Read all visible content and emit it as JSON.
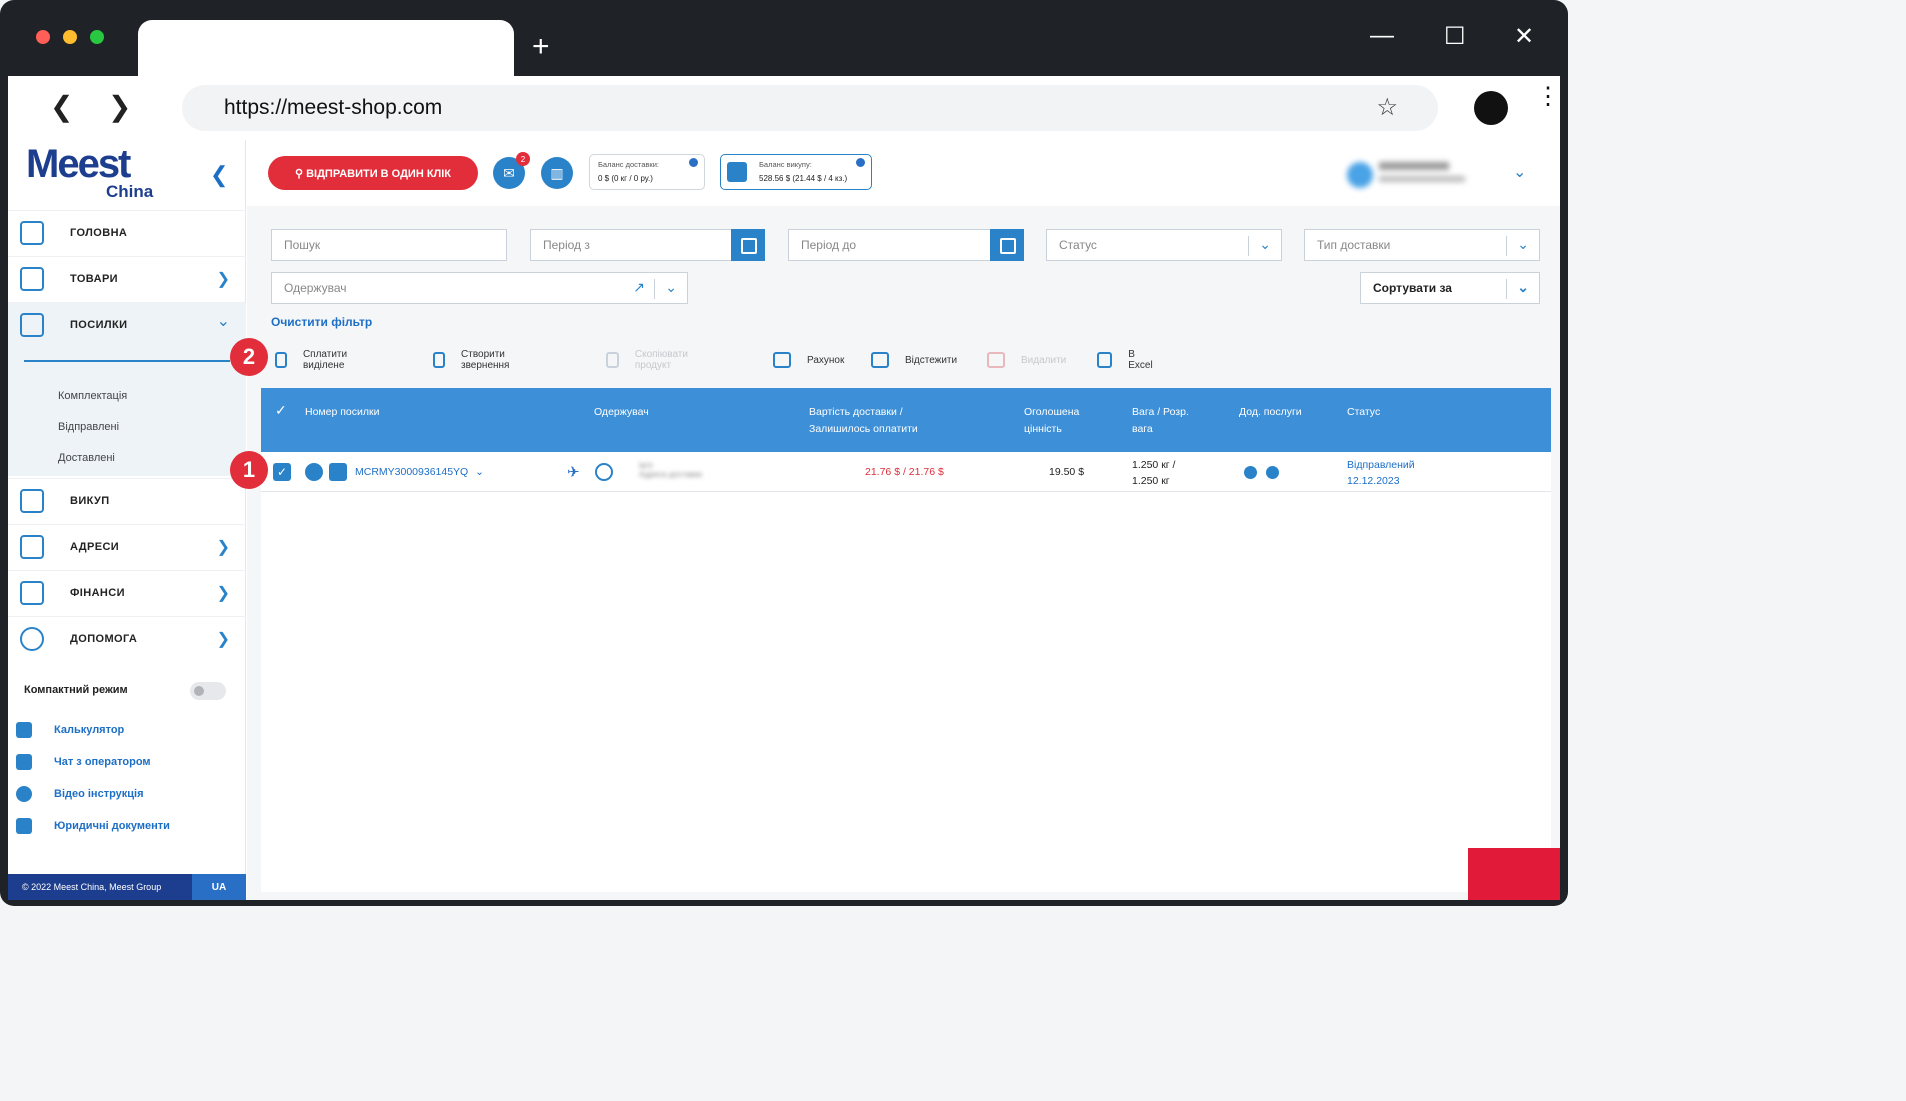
{
  "browser": {
    "url": "https://meest-shop.com",
    "new_tab": "+",
    "back": "❮",
    "forward": "❯",
    "minimize": "—",
    "maximize": "☐",
    "close": "✕",
    "star": "☆",
    "menu": "⋮",
    "traffic_lights": {
      "red": "#ff5f57",
      "yellow": "#febc2e",
      "green": "#28c840"
    }
  },
  "logo": {
    "main": "Meest",
    "sub": "China"
  },
  "sidebar": {
    "collapse": "❮",
    "items": [
      {
        "label": "Головна",
        "chevron": ""
      },
      {
        "label": "Товари",
        "chevron": "❯"
      },
      {
        "label": "Посилки",
        "chevron": "⌄"
      },
      {
        "label": "Викуп",
        "chevron": ""
      },
      {
        "label": "Адреси",
        "chevron": "❯"
      },
      {
        "label": "Фінанси",
        "chevron": "❯"
      },
      {
        "label": "Допомога",
        "chevron": "❯"
      }
    ],
    "submenu": [
      "Комплектація",
      "Відправлені",
      "Доставлені"
    ],
    "compact_label": "Компактний режим",
    "links": [
      "Калькулятор",
      "Чат з оператором",
      "Відео інструкція",
      "Юридичні документи"
    ],
    "footer_copy": "© 2022 Meest China, Meest Group",
    "footer_lang": "UA"
  },
  "header": {
    "send_button": "⚲ ВІДПРАВИТИ В ОДИН КЛІК",
    "mail_badge": "2",
    "delivery_balance_title": "Баланс доставки:",
    "delivery_balance_value": "0 $ (0 кг / 0 ру.)",
    "purchase_balance_title": "Баланс викупу:",
    "purchase_balance_value": "528.56 $ (21.44 $ / 4 кз.)",
    "user_chevron": "⌄"
  },
  "filters": {
    "search_placeholder": "Пошук",
    "period_from": "Період з",
    "period_to": "Період до",
    "status": "Статус",
    "delivery_type": "Тип доставки",
    "recipient": "Одержувач",
    "sort_by": "Сортувати за",
    "clear": "Очистити фільтр",
    "chevron": "⌄"
  },
  "actions": [
    {
      "label": "Сплатити виділене",
      "enabled": true
    },
    {
      "label": "Створити звернення",
      "enabled": true
    },
    {
      "label": "Скопіювати продукт",
      "enabled": false
    },
    {
      "label": "Рахунок",
      "enabled": true
    },
    {
      "label": "Відстежити",
      "enabled": true
    },
    {
      "label": "Видалити",
      "enabled": false
    },
    {
      "label": "В Excel",
      "enabled": true
    }
  ],
  "markers": {
    "one": "1",
    "two": "2"
  },
  "table": {
    "check": "✓",
    "headers": {
      "number": "Номер посилки",
      "recipient": "Одержувач",
      "cost_1": "Вартість доставки /",
      "cost_2": "Залишилось оплатити",
      "declared_1": "Оголошена",
      "declared_2": "цінність",
      "weight_1": "Вага / Розр.",
      "weight_2": "вага",
      "services": "Дод. послуги",
      "status": "Статус"
    },
    "rows": [
      {
        "number": "MCRMY3000936145YQ",
        "recipient_name": "Ім'я",
        "recipient_addr": "Адреса доставки",
        "cost": "21.76 $ / 21.76 $",
        "declared": "19.50 $",
        "weight_1": "1.250 кг /",
        "weight_2": "1.250 кг",
        "status": "Відправлений",
        "date": "12.12.2023"
      }
    ]
  }
}
